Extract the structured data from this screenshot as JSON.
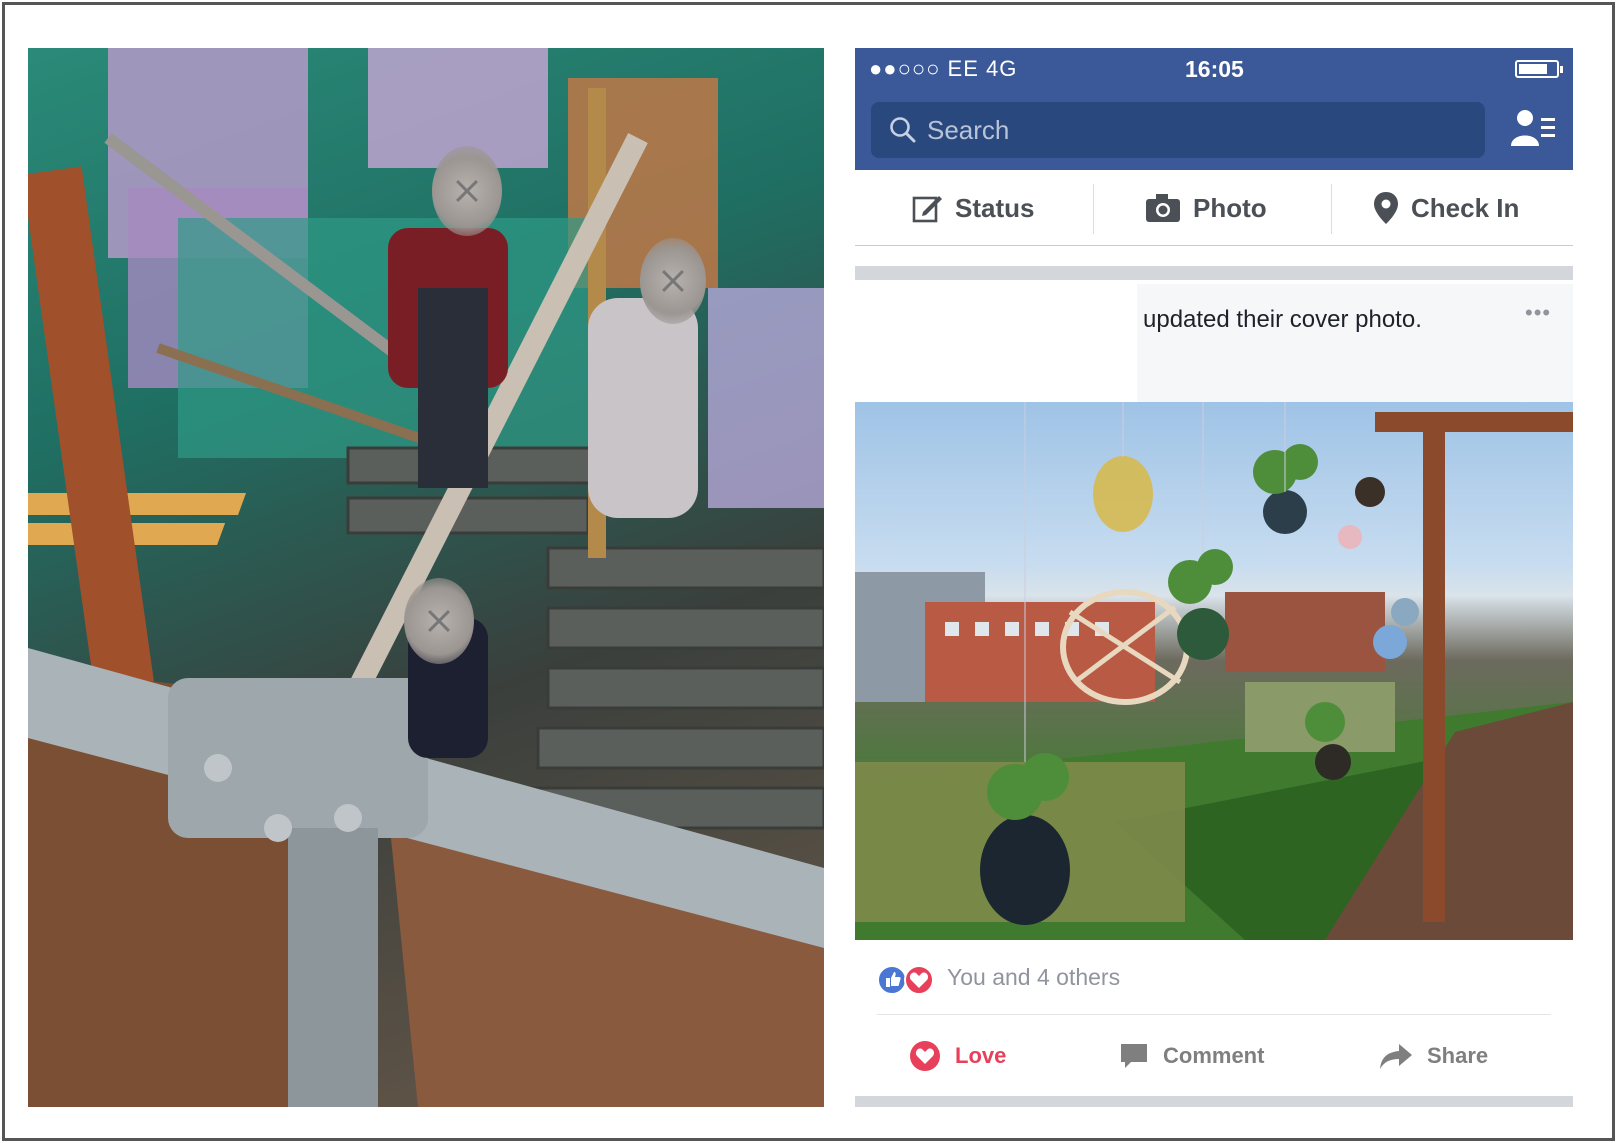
{
  "status_bar": {
    "carrier": "●●○○○ EE   4G",
    "time": "16:05"
  },
  "search": {
    "placeholder": "Search"
  },
  "composer": {
    "status_label": "Status",
    "photo_label": "Photo",
    "checkin_label": "Check In"
  },
  "post": {
    "header_text": "updated their cover photo.",
    "more_label": "•••",
    "reactions_text": "You and 4 others"
  },
  "actions": {
    "love_label": "Love",
    "comment_label": "Comment",
    "share_label": "Share"
  },
  "colors": {
    "brand": "#3b5998",
    "love": "#e8405a",
    "like": "#4a77d4"
  }
}
